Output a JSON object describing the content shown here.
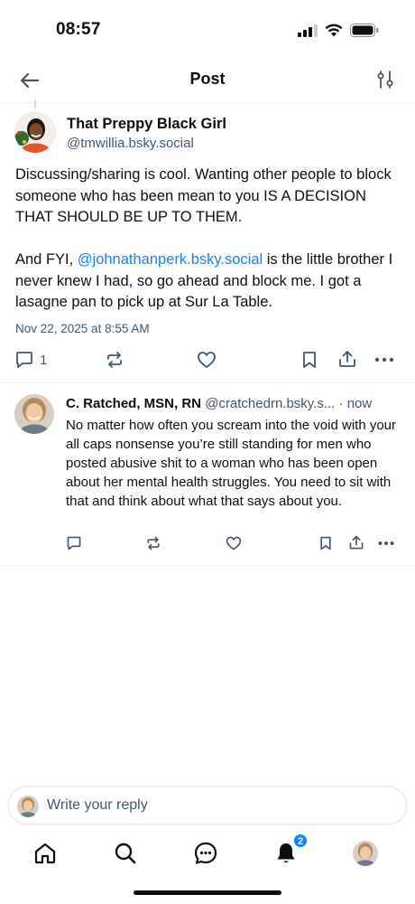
{
  "status_bar": {
    "time": "08:57"
  },
  "header": {
    "title": "Post"
  },
  "post": {
    "author_name": "That Preppy Black Girl",
    "author_handle": "@tmwillia.bsky.social",
    "text_part1": "Discussing/sharing is cool. Wanting other people to block someone who has been mean to you IS A DECISION THAT SHOULD BE UP TO THEM.\n\nAnd FYI, ",
    "mention": "@johnathanperk.bsky.social",
    "text_part2": " is the little brother I never knew I had, so go ahead and block me. I got a lasagne pan to pick up at Sur La Table.",
    "date": "Nov 22, 2025 at 8:55 AM",
    "reply_count": "1"
  },
  "reply": {
    "author_name": "C. Ratched, MSN, RN",
    "author_handle": "@cratchedrn.bsky.s...",
    "time": " · now",
    "text": "No matter how often you scream into the void with your all caps nonsense you’re still standing for men who posted abusive shit to a woman who has been open about her mental health struggles. You need to sit with that and think about what that says about you."
  },
  "composer": {
    "placeholder": "Write your reply"
  },
  "nav": {
    "notification_badge": "2"
  },
  "colors": {
    "accent": "#1083fe",
    "muted_text": "#42576c",
    "divider": "#eef1f4"
  },
  "icons": [
    "back-arrow-icon",
    "filter-sliders-icon",
    "comment-icon",
    "repost-icon",
    "heart-icon",
    "bookmark-icon",
    "share-icon",
    "more-icon",
    "home-icon",
    "search-icon",
    "chat-icon",
    "bell-icon"
  ]
}
